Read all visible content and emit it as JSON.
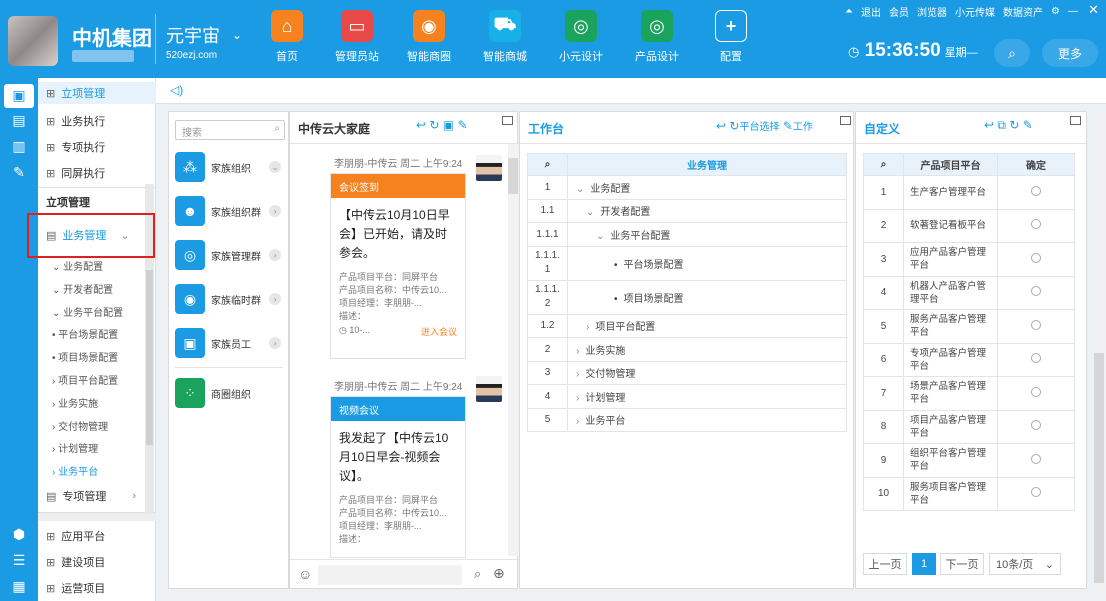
{
  "header": {
    "company": "中机集团",
    "brand": "元宇宙",
    "brand_url": "520ezj.com",
    "clock": "15:36:50",
    "weekday": "星期—",
    "more": "更多",
    "nav": [
      {
        "label": "首页",
        "icon": "home-icon",
        "color": "#f6821f"
      },
      {
        "label": "管理员站",
        "icon": "monitor-icon",
        "color": "#e84a4a"
      },
      {
        "label": "智能商圈",
        "icon": "circle-icon",
        "color": "#f6821f"
      },
      {
        "label": "智能商城",
        "icon": "cart-icon",
        "color": "#17b1e8"
      },
      {
        "label": "小元设计",
        "icon": "globe-icon",
        "color": "#1aa35c"
      },
      {
        "label": "产品设计",
        "icon": "globe-icon",
        "color": "#1aa35c"
      },
      {
        "label": "配置",
        "icon": "plus-icon",
        "color": "transparent"
      }
    ],
    "links": [
      "退出",
      "会员",
      "浏览器",
      "小元传媒",
      "数据资产"
    ]
  },
  "sidebar": {
    "top": "立项管理",
    "items": [
      "业务执行",
      "专项执行",
      "同屏执行"
    ],
    "section": "立项管理",
    "active": "业务管理",
    "sub": [
      "业务配置",
      "开发者配置",
      "业务平台配置",
      "平台场景配置",
      "项目场景配置",
      "项目平台配置",
      "业务实施",
      "交付物管理",
      "计划管理",
      "业务平台"
    ],
    "bottom": "专项管理",
    "bottom_items": [
      "应用平台",
      "建设项目",
      "运营项目"
    ]
  },
  "groups": {
    "search_placeholder": "搜索",
    "items": [
      "家族组织",
      "家族组织群",
      "家族管理群",
      "家族临时群",
      "家族员工",
      "商圈组织"
    ]
  },
  "chat": {
    "title": "中传云大家庭",
    "m1": {
      "meta": "李朋朋-中传云 周二 上午9:24",
      "head": "会议签到",
      "title": "【中传云10月10日早会】已开始，请及时参会。",
      "lines": [
        "产品项目平台：同屏平台",
        "产品项目名称：中传云10...",
        "项目经理：李朋朋-...",
        "描述："
      ],
      "date": "10-...",
      "link": "进入会议"
    },
    "m2": {
      "meta": "李朋朋-中传云 周二 上午9:24",
      "head": "视频会议",
      "title": "我发起了【中传云10月10日早会-视频会议】。",
      "lines": [
        "产品项目平台：同屏平台",
        "产品项目名称：中传云10...",
        "项目经理：李朋朋-...",
        "描述："
      ]
    }
  },
  "work": {
    "title": "工作台",
    "actions": [
      "平台选择",
      "工作"
    ],
    "col": "业务管理",
    "rows": [
      {
        "n": "1",
        "t": "业务配置",
        "lv": 0,
        "arr": "⌄"
      },
      {
        "n": "1.1",
        "t": "开发者配置",
        "lv": 1,
        "arr": "⌄"
      },
      {
        "n": "1.1.1",
        "t": "业务平台配置",
        "lv": 2,
        "arr": "⌄"
      },
      {
        "n": "1.1.1.1",
        "t": "平台场景配置",
        "lv": 3,
        "arr": "•"
      },
      {
        "n": "1.1.1.2",
        "t": "项目场景配置",
        "lv": 3,
        "arr": "•"
      },
      {
        "n": "1.2",
        "t": "项目平台配置",
        "lv": 1,
        "arr": "›"
      },
      {
        "n": "2",
        "t": "业务实施",
        "lv": 0,
        "arr": "›"
      },
      {
        "n": "3",
        "t": "交付物管理",
        "lv": 0,
        "arr": "›"
      },
      {
        "n": "4",
        "t": "计划管理",
        "lv": 0,
        "arr": "›"
      },
      {
        "n": "5",
        "t": "业务平台",
        "lv": 0,
        "arr": "›"
      }
    ]
  },
  "custom": {
    "title": "自定义",
    "col1": "产品项目平台",
    "col2": "确定",
    "rows": [
      "生产客户管理平台",
      "软著登记看板平台",
      "应用产品客户管理平台",
      "机器人产品客户管理平台",
      "服务产品客户管理平台",
      "专项产品客户管理平台",
      "场景产品客户管理平台",
      "项目产品客户管理平台",
      "组织平台客户管理平台",
      "服务项目客户管理平台"
    ],
    "prev": "上一页",
    "page": "1",
    "next": "下一页",
    "per": "10条/页"
  }
}
